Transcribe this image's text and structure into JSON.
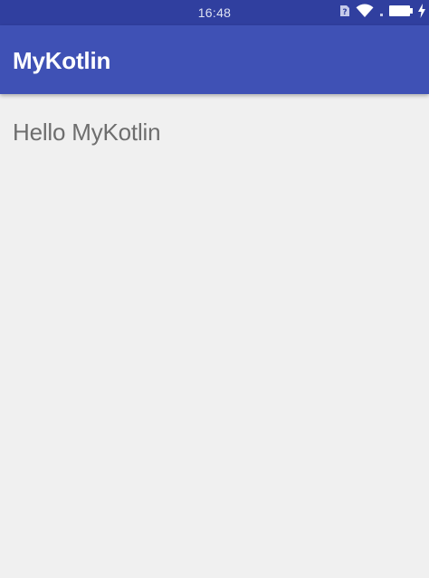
{
  "status_bar": {
    "time": "16:48",
    "icons": [
      "sim-unknown-icon",
      "wifi-icon",
      "battery-charging-icon"
    ],
    "color": "#303f9f"
  },
  "app_bar": {
    "title": "MyKotlin",
    "color": "#3f51b5"
  },
  "content": {
    "text": "Hello MyKotlin",
    "background": "#f0f0f0"
  }
}
